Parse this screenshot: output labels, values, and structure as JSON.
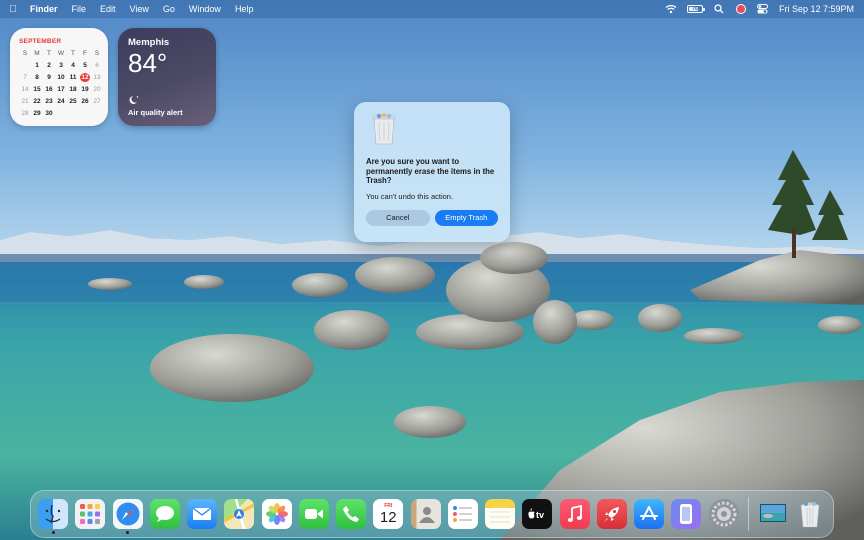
{
  "menubar": {
    "app_name": "Finder",
    "menus": [
      "File",
      "Edit",
      "View",
      "Go",
      "Window",
      "Help"
    ],
    "battery_text": "76",
    "battery_level": 0.76,
    "clock": "Fri Sep 12  7:59PM"
  },
  "calendar": {
    "month": "SEPTEMBER",
    "weekdays": [
      "S",
      "M",
      "T",
      "W",
      "T",
      "F",
      "S"
    ],
    "days": [
      [
        "",
        "1",
        "2",
        "3",
        "4",
        "5",
        "6"
      ],
      [
        "7",
        "8",
        "9",
        "10",
        "11",
        "12",
        "13"
      ],
      [
        "14",
        "15",
        "16",
        "17",
        "18",
        "19",
        "20"
      ],
      [
        "21",
        "22",
        "23",
        "24",
        "25",
        "26",
        "27"
      ],
      [
        "28",
        "29",
        "30",
        "",
        "",
        "",
        ""
      ]
    ],
    "today": "12"
  },
  "weather": {
    "city": "Memphis",
    "temperature": "84°",
    "condition": "Air quality alert"
  },
  "dialog": {
    "title": "Are you sure you want to permanently erase the items in the Trash?",
    "message": "You can't undo this action.",
    "cancel_label": "Cancel",
    "confirm_label": "Empty Trash"
  },
  "dock": {
    "calendar_month": "FRI",
    "calendar_day": "12",
    "apps": [
      {
        "name": "Finder",
        "icon": "finder-icon",
        "running": true
      },
      {
        "name": "Launchpad",
        "icon": "launchpad-icon",
        "running": false
      },
      {
        "name": "Safari",
        "icon": "safari-icon",
        "running": true
      },
      {
        "name": "Messages",
        "icon": "messages-icon",
        "running": false
      },
      {
        "name": "Mail",
        "icon": "mail-icon",
        "running": false
      },
      {
        "name": "Maps",
        "icon": "maps-icon",
        "running": false
      },
      {
        "name": "Photos",
        "icon": "photos-icon",
        "running": false
      },
      {
        "name": "FaceTime",
        "icon": "facetime-icon",
        "running": false
      },
      {
        "name": "Phone",
        "icon": "phone-icon",
        "running": false
      },
      {
        "name": "Calendar",
        "icon": "calendar-icon",
        "running": false
      },
      {
        "name": "Contacts",
        "icon": "contacts-icon",
        "running": false
      },
      {
        "name": "Reminders",
        "icon": "reminders-icon",
        "running": false
      },
      {
        "name": "Notes",
        "icon": "notes-icon",
        "running": false
      },
      {
        "name": "Apple TV",
        "icon": "apple-tv-icon",
        "running": false
      },
      {
        "name": "Music",
        "icon": "music-icon",
        "running": false
      },
      {
        "name": "Rocket Typist",
        "icon": "rocket-icon",
        "running": false
      },
      {
        "name": "App Store",
        "icon": "app-store-icon",
        "running": false
      },
      {
        "name": "iPhone Mirroring",
        "icon": "iphone-mirroring-icon",
        "running": false
      },
      {
        "name": "System Settings",
        "icon": "system-settings-icon",
        "running": false
      }
    ],
    "recent": [
      {
        "name": "Downloads stack",
        "icon": "desktop-image-stack-icon"
      },
      {
        "name": "Trash",
        "icon": "trash-full-icon"
      }
    ]
  }
}
